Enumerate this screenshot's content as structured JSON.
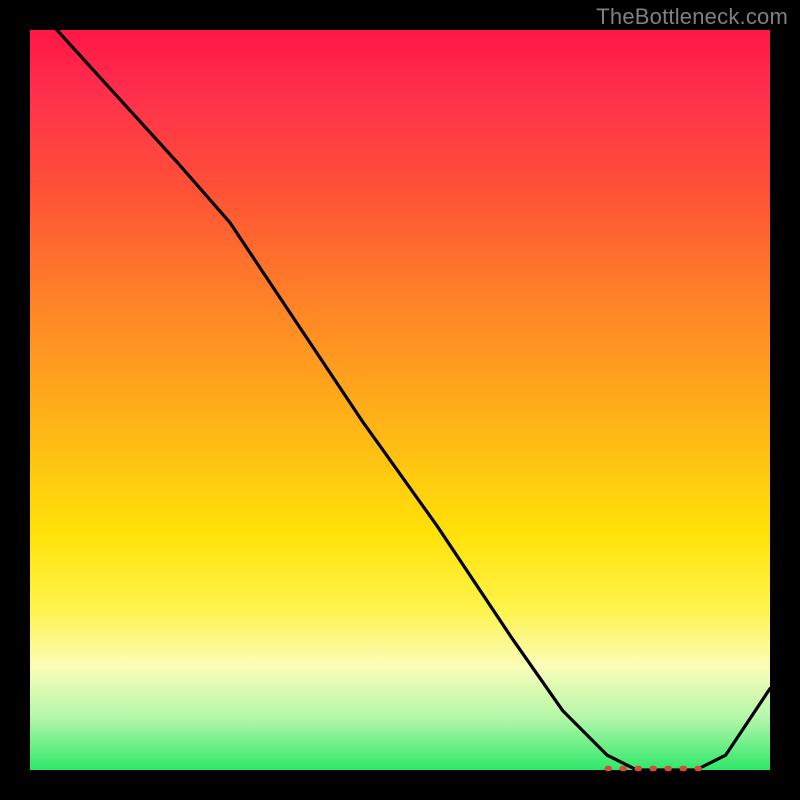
{
  "watermark": "TheBottleneck.com",
  "chart_data": {
    "type": "line",
    "title": "",
    "xlabel": "",
    "ylabel": "",
    "xlim": [
      0,
      100
    ],
    "ylim": [
      0,
      100
    ],
    "grid": false,
    "legend": false,
    "series": [
      {
        "name": "bottleneck-curve",
        "x": [
          0,
          10,
          20,
          27,
          35,
          45,
          55,
          65,
          72,
          78,
          82,
          86,
          90,
          94,
          100
        ],
        "y": [
          104,
          93,
          82,
          74,
          62,
          47,
          33,
          18,
          8,
          2,
          0,
          0,
          0,
          2,
          11
        ]
      }
    ],
    "marker_range": {
      "x_start": 78,
      "x_end": 92,
      "y": 0.2
    },
    "colors": {
      "curve": "#000000",
      "marker": "#d64a3a",
      "gradient_top": "#ff1744",
      "gradient_bottom": "#2ee86a",
      "frame": "#000000",
      "watermark": "#808080"
    }
  }
}
